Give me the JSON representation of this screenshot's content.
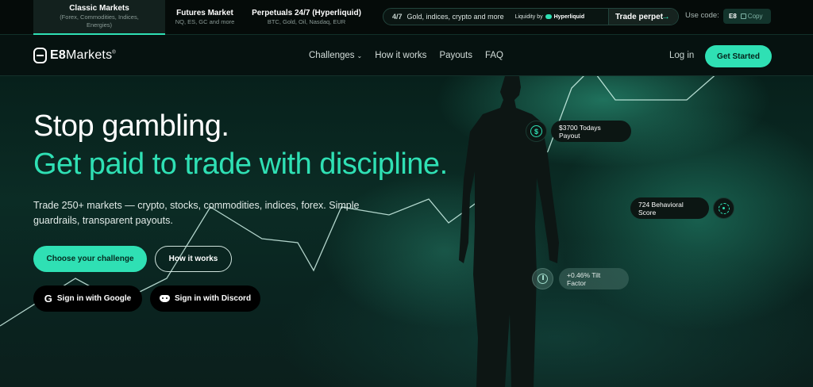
{
  "market_tabs": [
    {
      "title": "Classic Markets",
      "subtitle": "(Forex, Commodities, Indices, Energies)"
    },
    {
      "title": "Futures Market",
      "subtitle": "NQ, ES, GC and more"
    },
    {
      "title": "Perpetuals 24/7 (Hyperliquid)",
      "subtitle": "BTC, Gold, Oil, Nasdaq, EUR"
    }
  ],
  "ticker": {
    "head": "4/7",
    "text": "Gold, indices, crypto and more",
    "liquidity_label": "Liquidity by",
    "liquidity_brand": "Hyperliquid",
    "cta": "Trade perpet",
    "arrow": "→"
  },
  "promo": {
    "label": "Use code:",
    "code": "E8",
    "copy": "Copy"
  },
  "nav": {
    "brand_bold": "E8",
    "brand_rest": "Markets",
    "brand_tm": "®",
    "links": [
      "Challenges",
      "How it works",
      "Payouts",
      "FAQ"
    ],
    "challenges_chevron": "⌄",
    "login": "Log in",
    "cta": "Get Started"
  },
  "hero": {
    "title": "Stop gambling.",
    "subtitle": "Get paid to trade with discipline.",
    "description": "Trade 250+ markets — crypto, stocks, commodities, indices, forex. Simple guardrails, transparent payouts.",
    "primary_button": "Choose your challenge",
    "secondary_button": "How it works",
    "google_button": "Sign in with Google",
    "google_icon_glyph": "G",
    "discord_button": "Sign in with Discord"
  },
  "floating_stats": {
    "payout": "$3700 Todays Payout",
    "payout_icon_glyph": "$",
    "behavioral": "724 Behavioral Score",
    "tilt": "+0.46% Tilt Factor"
  },
  "colors": {
    "accent": "#2fe0b4",
    "background": "#06110e"
  }
}
